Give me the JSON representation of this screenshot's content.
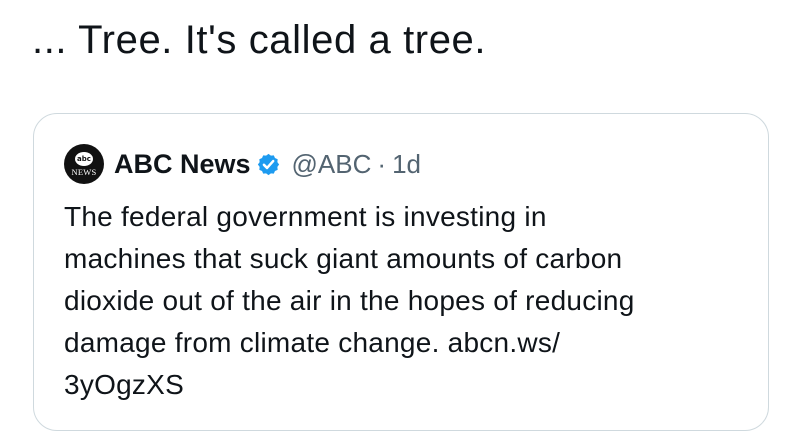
{
  "tweet": {
    "text": "... Tree. It's called a tree."
  },
  "quoted_tweet": {
    "avatar_logo": "abc",
    "avatar_news": "NEWS",
    "display_name": "ABC News",
    "verified_icon": "verified-badge-icon",
    "handle": "@ABC",
    "separator": "·",
    "age": "1d",
    "body": "The federal government is investing in\nmachines that suck giant amounts of carbon\ndioxide out of the air in the hopes of reducing\ndamage from climate change. abcn.ws/\n3yOgzXS"
  },
  "colors": {
    "verified_blue": "#1d9bf0",
    "secondary_text": "#536471",
    "border": "#cfd9de"
  }
}
